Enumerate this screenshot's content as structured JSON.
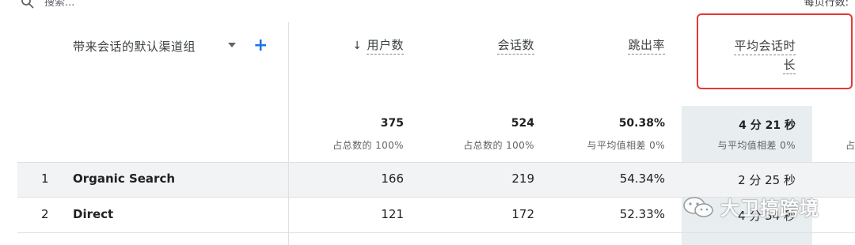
{
  "search": {
    "placeholder": "搜索..."
  },
  "rows_per_page_label": "每页行数:",
  "table": {
    "dimension_header": "带来会话的默认渠道组",
    "columns": [
      {
        "label": "用户数",
        "sorted": "desc",
        "total": "375",
        "pct": "占总数的 100%"
      },
      {
        "label": "会话数",
        "total": "524",
        "pct": "占总数的 100%"
      },
      {
        "label": "跳出率",
        "total": "50.38%",
        "pct": "与平均值相差 0%"
      },
      {
        "label_line1": "平均会话时",
        "label_line2": "长",
        "total": "4 分 21 秒",
        "pct": "与平均值相差 0%"
      }
    ],
    "next_col_pct_partial": "占",
    "rows": [
      {
        "index": "1",
        "name": "Organic Search",
        "users": "166",
        "sessions": "219",
        "bounce": "54.34%",
        "avg": "2 分 25 秒"
      },
      {
        "index": "2",
        "name": "Direct",
        "users": "121",
        "sessions": "172",
        "bounce": "52.33%",
        "avg": "4 分 34 秒"
      }
    ]
  },
  "watermark": {
    "text": "大卫搞跨境"
  },
  "colors": {
    "accent": "#1a73e8",
    "highlight_box": "#e53935",
    "highlight_col": "#e8eef0"
  }
}
